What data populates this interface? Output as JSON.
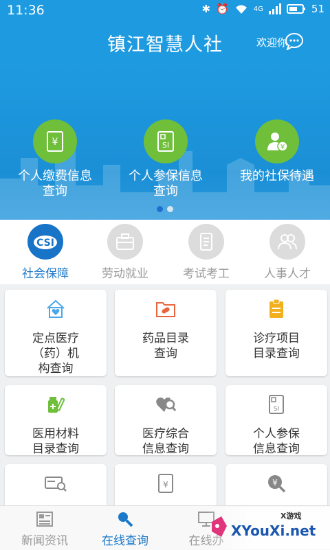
{
  "status": {
    "time": "11:36",
    "network": "4G",
    "battery": "51"
  },
  "header": {
    "title": "镇江智慧人社",
    "welcome": "欢迎你"
  },
  "banner": {
    "items": [
      {
        "label_line1": "个人缴费信息",
        "label_line2": "查询",
        "icon": "payment-info-icon"
      },
      {
        "label_line1": "个人参保信息",
        "label_line2": "查询",
        "icon": "insurance-si-icon"
      },
      {
        "label_line1": "我的社保待遇",
        "label_line2": "",
        "icon": "benefit-person-icon"
      }
    ],
    "pager": {
      "current": 1,
      "total": 2
    }
  },
  "categories": [
    {
      "label": "社会保障",
      "active": true
    },
    {
      "label": "劳动就业",
      "active": false
    },
    {
      "label": "考试考工",
      "active": false
    },
    {
      "label": "人事人才",
      "active": false
    }
  ],
  "services": [
    {
      "line1": "定点医疗",
      "line2": "（药）机",
      "line3": "构查询",
      "icon": "medical-house-icon",
      "color": "#4aa8e8"
    },
    {
      "line1": "药品目录",
      "line2": "查询",
      "line3": "",
      "icon": "pill-folder-icon",
      "color": "#e8663d"
    },
    {
      "line1": "诊疗项目",
      "line2": "目录查询",
      "line3": "",
      "icon": "clipboard-icon",
      "color": "#f2b01e"
    },
    {
      "line1": "医用材料",
      "line2": "目录查询",
      "line3": "",
      "icon": "medicine-bottle-icon",
      "color": "#6fbf3b"
    },
    {
      "line1": "医疗综合",
      "line2": "信息查询",
      "line3": "",
      "icon": "heart-search-icon",
      "color": "#888888"
    },
    {
      "line1": "个人参保",
      "line2": "信息查询",
      "line3": "",
      "icon": "si-document-icon",
      "color": "#888888"
    },
    {
      "line1": "",
      "line2": "",
      "line3": "",
      "icon": "card-search-icon",
      "color": "#888888"
    },
    {
      "line1": "",
      "line2": "",
      "line3": "",
      "icon": "yen-document-icon",
      "color": "#888888"
    },
    {
      "line1": "",
      "line2": "",
      "line3": "",
      "icon": "yen-search-icon",
      "color": "#888888"
    }
  ],
  "bottom_nav": [
    {
      "label": "新闻资讯",
      "active": false
    },
    {
      "label": "在线查询",
      "active": true
    },
    {
      "label": "在线办",
      "active": false
    }
  ],
  "watermark": {
    "brand": "XYouXi.net",
    "tag": "X游戏"
  },
  "colors": {
    "primary": "#1e9ae0",
    "accent_green": "#6fbf3b",
    "active_blue": "#1c79c9"
  }
}
